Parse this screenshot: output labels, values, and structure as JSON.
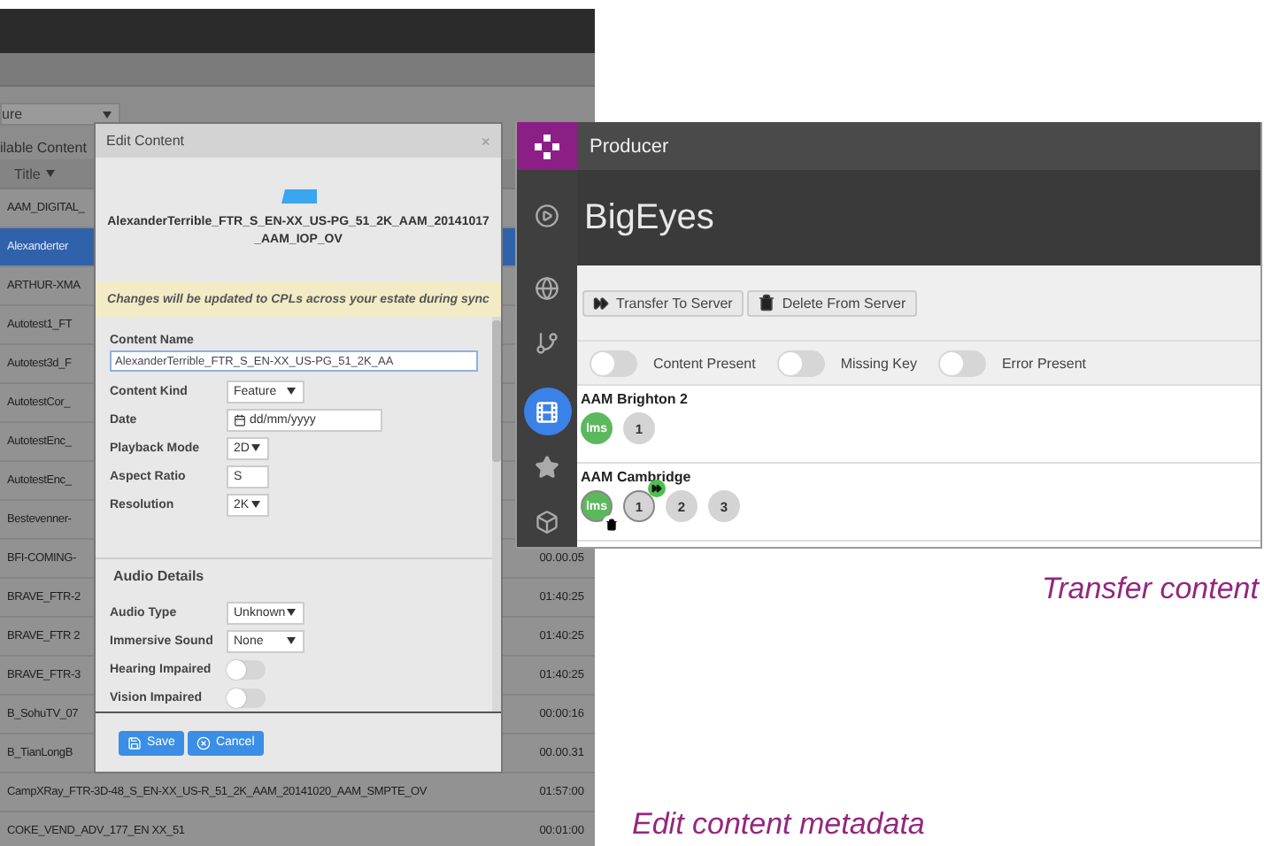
{
  "content_list": {
    "filter": {
      "value": "ure"
    },
    "heading": "ilable Content",
    "column": "Title",
    "rows": [
      {
        "title": "AAM_DIGITAL_",
        "selected": false
      },
      {
        "title": "Alexanderter",
        "selected": true
      },
      {
        "title": "ARTHUR-XMA",
        "selected": false
      },
      {
        "title": "Autotest1_FT",
        "selected": false
      },
      {
        "title": "Autotest3d_F",
        "selected": false
      },
      {
        "title": "AutotestCor_",
        "selected": false
      },
      {
        "title": "AutotestEnc_",
        "selected": false
      },
      {
        "title": "AutotestEnc_",
        "selected": false
      },
      {
        "title": "Bestevenner-",
        "selected": false
      },
      {
        "title": "BFI-COMING-",
        "time": "00.00.05",
        "selected": false
      },
      {
        "title": "BRAVE_FTR-2",
        "time": "01:40:25",
        "selected": false
      },
      {
        "title": "BRAVE_FTR 2",
        "time": "01:40:25",
        "selected": false
      },
      {
        "title": "BRAVE_FTR-3",
        "time": "01:40:25",
        "selected": false
      },
      {
        "title": "B_SohuTV_07",
        "time": "00:00:16",
        "selected": false
      },
      {
        "title": "B_TianLongB",
        "time": "00.00.31",
        "selected": false
      },
      {
        "title": "CampXRay_FTR-3D-48_S_EN-XX_US-R_51_2K_AAM_20141020_AAM_SMPTE_OV",
        "time": "01:57:00",
        "selected": false
      },
      {
        "title": "COKE_VEND_ADV_177_EN XX_51",
        "time": "00:01:00",
        "selected": false
      }
    ]
  },
  "edit_dialog": {
    "title": "Edit Content",
    "close": "×",
    "content_title": "AlexanderTerrible_FTR_S_EN-XX_US-PG_51_2K_AAM_20141017_AAM_IOP_OV",
    "notice": "Changes will be updated to CPLs across your estate during sync",
    "fields": [
      {
        "label": "Content Name",
        "kind": "wide",
        "value": "AlexanderTerrible_FTR_S_EN-XX_US-PG_51_2K_AA"
      },
      {
        "label": "Content Kind",
        "kind": "select",
        "value": "Feature"
      },
      {
        "label": "Date",
        "kind": "date",
        "placeholder": "dd/mm/yyyy"
      },
      {
        "label": "Playback Mode",
        "kind": "select",
        "value": "2D"
      },
      {
        "label": "Aspect Ratio",
        "kind": "text",
        "value": "S"
      },
      {
        "label": "Resolution",
        "kind": "select",
        "value": "2K"
      }
    ],
    "audio_heading": "Audio Details",
    "audio_fields": [
      {
        "label": "Audio Type",
        "kind": "select",
        "value": "Unknown"
      },
      {
        "label": "Immersive Sound",
        "kind": "select",
        "value": "None"
      },
      {
        "label": "Hearing Impaired",
        "kind": "toggle",
        "on": false
      },
      {
        "label": "Vision Impaired",
        "kind": "toggle",
        "on": false
      }
    ],
    "buttons": [
      {
        "label": "Save",
        "kind": "save"
      },
      {
        "label": "Cancel",
        "kind": "cancel"
      }
    ]
  },
  "producer": {
    "app_title": "Producer",
    "page_title": "BigEyes",
    "nav": [
      {
        "kind": "play",
        "selected": false
      },
      {
        "kind": "globe",
        "selected": false
      },
      {
        "kind": "tree",
        "selected": false
      },
      {
        "kind": "film",
        "selected": true
      },
      {
        "kind": "star",
        "selected": false
      },
      {
        "kind": "cube",
        "selected": false
      }
    ],
    "actions": [
      {
        "label": "Transfer To Server",
        "kind": "transfer"
      },
      {
        "label": "Delete From Server",
        "kind": "delete"
      }
    ],
    "filters": [
      {
        "label": "Content Present",
        "on": false
      },
      {
        "label": "Missing Key",
        "on": false
      },
      {
        "label": "Error Present",
        "on": false
      }
    ],
    "sites": [
      {
        "name": "AAM Brighton 2",
        "badges": [
          {
            "label": "lms",
            "kind": "lms",
            "deleting": false,
            "transferring": false
          },
          {
            "label": "1",
            "kind": "screen",
            "deleting": false,
            "transferring": false
          }
        ]
      },
      {
        "name": "AAM Cambridge",
        "badges": [
          {
            "label": "lms",
            "kind": "lms",
            "deleting": true,
            "transferring": false
          },
          {
            "label": "1",
            "kind": "screen",
            "deleting": false,
            "transferring": true
          },
          {
            "label": "2",
            "kind": "screen",
            "deleting": false,
            "transferring": false
          },
          {
            "label": "3",
            "kind": "screen",
            "deleting": false,
            "transferring": false
          }
        ]
      }
    ]
  },
  "captions": [
    {
      "text": "Transfer content"
    },
    {
      "text": "Edit content metadata"
    }
  ]
}
